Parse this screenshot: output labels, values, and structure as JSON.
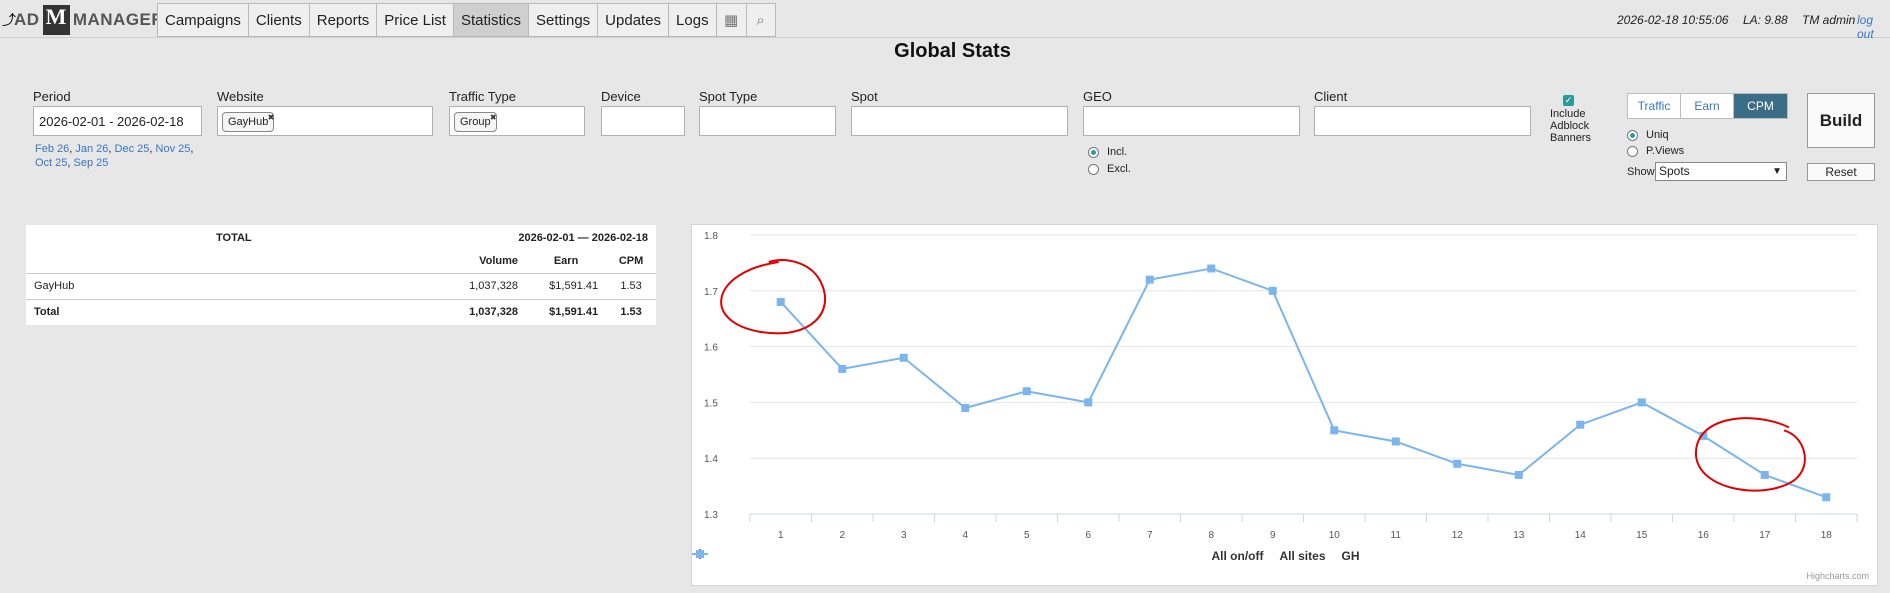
{
  "header": {
    "logo_left": "AD",
    "logo_mid": "M",
    "logo_right": "MANAGER",
    "nav": [
      "Campaigns",
      "Clients",
      "Reports",
      "Price List",
      "Statistics",
      "Settings",
      "Updates",
      "Logs"
    ],
    "active_nav": "Statistics",
    "icons": [
      "calendar-icon",
      "search-icon"
    ],
    "datetime": "2026-02-18 10:55:06",
    "load_avg": "LA: 9.88",
    "user": "TM admin",
    "logout": "log out"
  },
  "page_title": "Global Stats",
  "filters": {
    "period_label": "Period",
    "period_value": "2026-02-01 - 2026-02-18",
    "quick_periods": [
      "Feb 26",
      "Jan 26",
      "Dec 25",
      "Nov 25",
      "Oct 25",
      "Sep 25"
    ],
    "website_label": "Website",
    "website_chip": "GayHub",
    "traffic_type_label": "Traffic Type",
    "traffic_type_chip": "Group",
    "device_label": "Device",
    "spot_type_label": "Spot Type",
    "spot_label": "Spot",
    "geo_label": "GEO",
    "geo_incl": "Incl.",
    "geo_excl": "Excl.",
    "geo_selected": "Incl.",
    "client_label": "Client",
    "adblock_label": "Include Adblock Banners",
    "adblock_checked": true
  },
  "view": {
    "segments": [
      "Traffic",
      "Earn",
      "CPM"
    ],
    "active_segment": "CPM",
    "uniq_label": "Uniq",
    "pviews_label": "P.Views",
    "selected_metric": "Uniq",
    "show_label": "Show",
    "show_value": "Spots",
    "build_label": "Build",
    "reset_label": "Reset"
  },
  "table": {
    "total_header": "TOTAL",
    "range": "2026-02-01 — 2026-02-18",
    "columns": [
      "Volume",
      "Earn",
      "CPM"
    ],
    "rows": [
      {
        "name": "GayHub",
        "volume": "1,037,328",
        "earn": "$1,591.41",
        "cpm": "1.53"
      }
    ],
    "total": {
      "name": "Total",
      "volume": "1,037,328",
      "earn": "$1,591.41",
      "cpm": "1.53"
    }
  },
  "chart_data": {
    "type": "line",
    "x": [
      1,
      2,
      3,
      4,
      5,
      6,
      7,
      8,
      9,
      10,
      11,
      12,
      13,
      14,
      15,
      16,
      17,
      18
    ],
    "ylim": [
      1.3,
      1.8
    ],
    "yticks": [
      1.3,
      1.4,
      1.5,
      1.6,
      1.7,
      1.8
    ],
    "grid": true,
    "legend_position": "bottom",
    "legend": [
      {
        "label": "All on/off",
        "color": "#000000",
        "marker": "circle"
      },
      {
        "label": "All sites",
        "color": "#000000",
        "marker": "diamond"
      },
      {
        "label": "GH",
        "color": "#7cb5ec",
        "marker": "square"
      }
    ],
    "series": [
      {
        "name": "GH",
        "color": "#7cb5ec",
        "values": [
          1.68,
          1.56,
          1.58,
          1.49,
          1.52,
          1.5,
          1.72,
          1.74,
          1.7,
          1.45,
          1.43,
          1.39,
          1.37,
          1.46,
          1.5,
          1.44,
          1.37,
          1.33
        ]
      }
    ],
    "credit": "Highcharts.com",
    "annotation_color": "#e00000"
  }
}
